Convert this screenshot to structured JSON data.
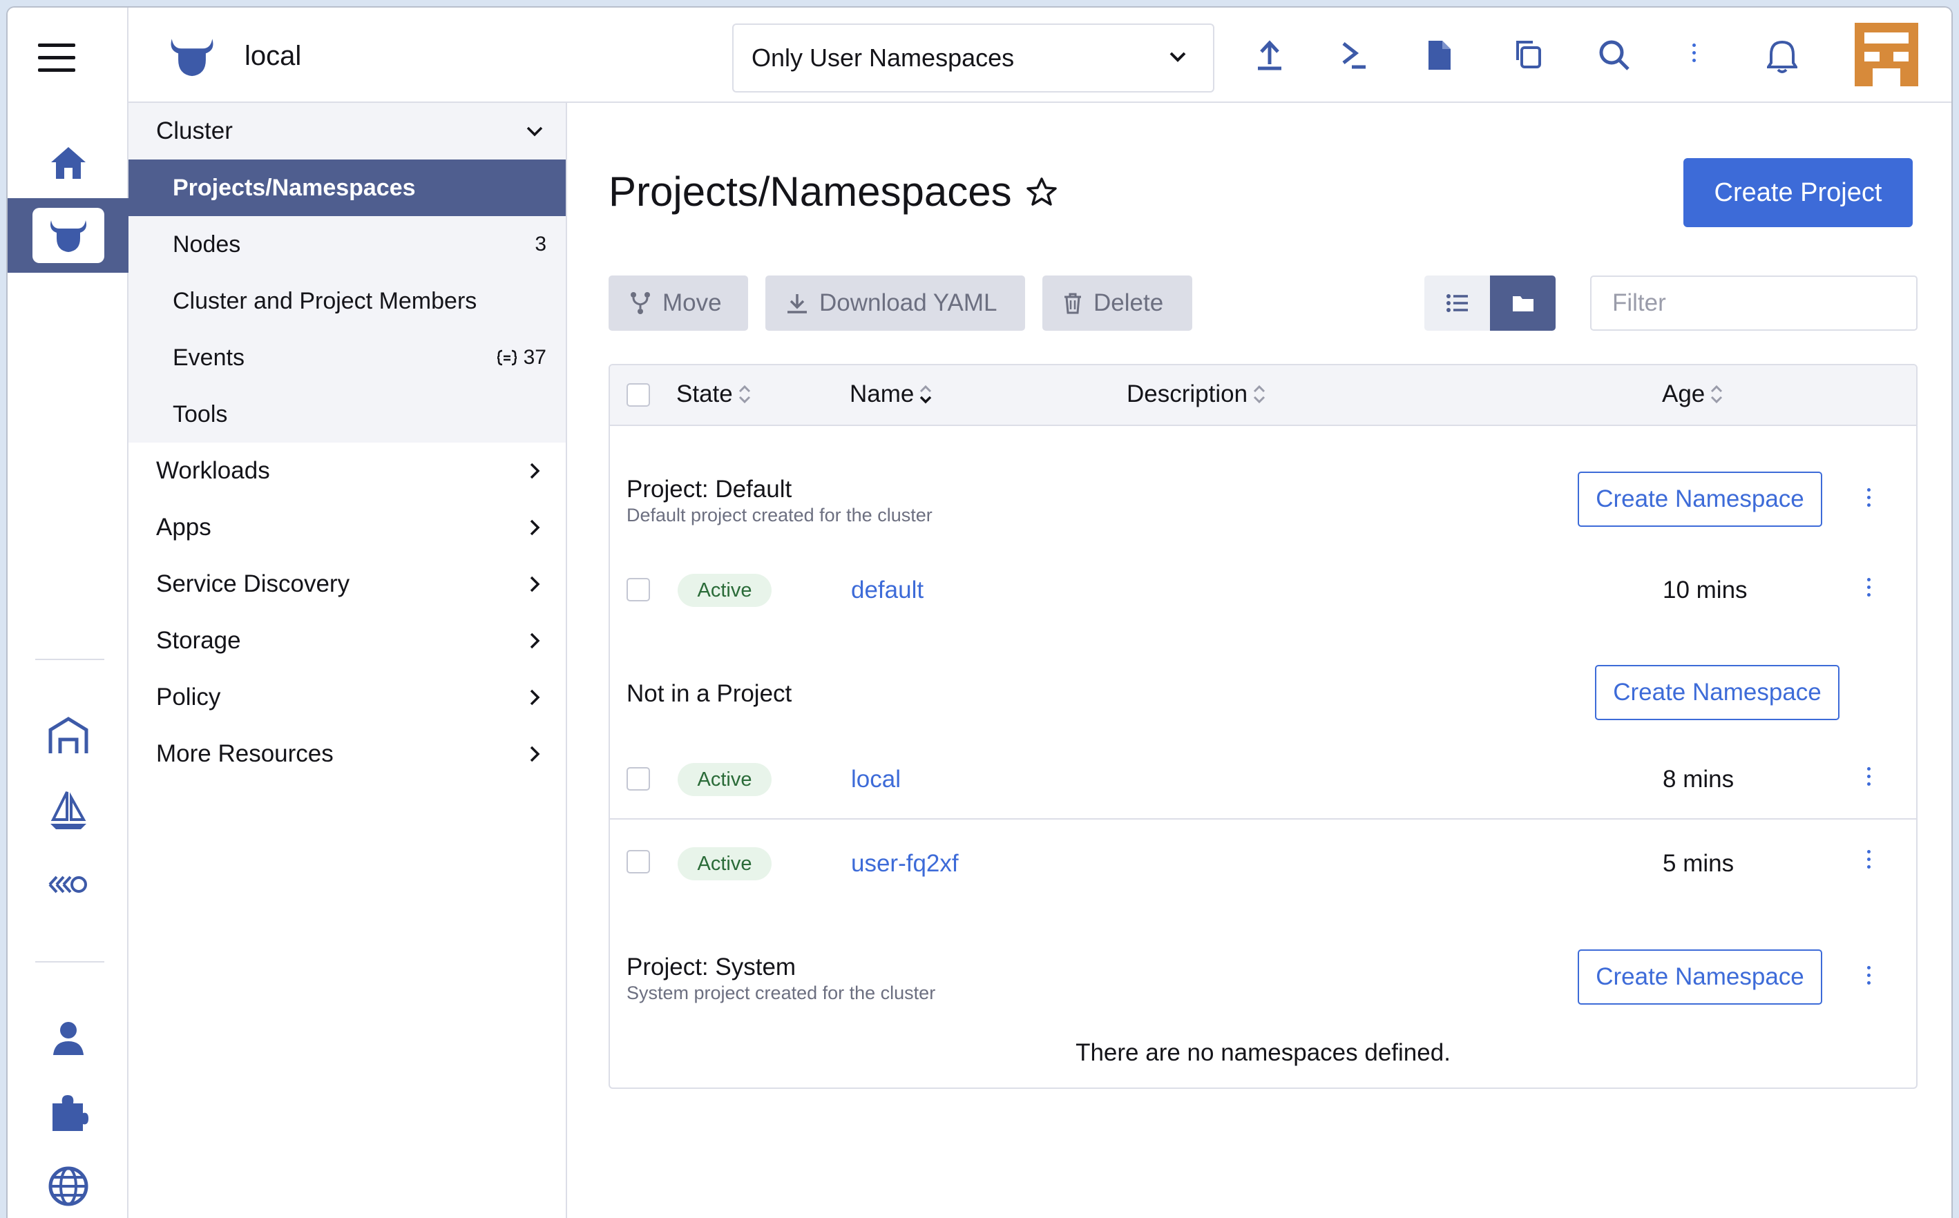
{
  "header": {
    "cluster_name": "local",
    "namespace_filter": "Only User Namespaces"
  },
  "nav": {
    "cluster_group": "Cluster",
    "cluster_items": [
      {
        "label": "Projects/Namespaces",
        "count": ""
      },
      {
        "label": "Nodes",
        "count": "3"
      },
      {
        "label": "Cluster and Project Members",
        "count": ""
      },
      {
        "label": "Events",
        "count": "37"
      },
      {
        "label": "Tools",
        "count": ""
      }
    ],
    "groups": [
      "Workloads",
      "Apps",
      "Service Discovery",
      "Storage",
      "Policy",
      "More Resources"
    ]
  },
  "main": {
    "title": "Projects/Namespaces",
    "create_project": "Create Project",
    "bulk": {
      "move": "Move",
      "download": "Download YAML",
      "delete": "Delete"
    },
    "filter_placeholder": "Filter",
    "columns": {
      "state": "State",
      "name": "Name",
      "description": "Description",
      "age": "Age"
    },
    "create_namespace": "Create Namespace",
    "groups": [
      {
        "label": "Project:  Default",
        "desc": "Default project created for the cluster",
        "rows": [
          {
            "state": "Active",
            "name": "default",
            "age": "10 mins"
          }
        ]
      },
      {
        "label": "Not in a Project",
        "desc": "",
        "rows": [
          {
            "state": "Active",
            "name": "local",
            "age": "8 mins"
          },
          {
            "state": "Active",
            "name": "user-fq2xf",
            "age": "5 mins"
          }
        ]
      },
      {
        "label": "Project:  System",
        "desc": "System project created for the cluster",
        "empty": "There are no namespaces defined."
      }
    ]
  },
  "colors": {
    "accent": "#3d6bd8",
    "nav_active": "#4f5e8f",
    "avatar": "#d78a3a"
  },
  "icons": [
    "hamburger-icon",
    "home-icon",
    "cluster-bull-icon",
    "warehouse-icon",
    "sailboat-icon",
    "chain-icon",
    "user-icon",
    "puzzle-icon",
    "globe-icon",
    "upload-icon",
    "terminal-icon",
    "file-icon",
    "copy-icon",
    "search-icon",
    "kebab-icon",
    "bell-icon",
    "star-icon"
  ]
}
